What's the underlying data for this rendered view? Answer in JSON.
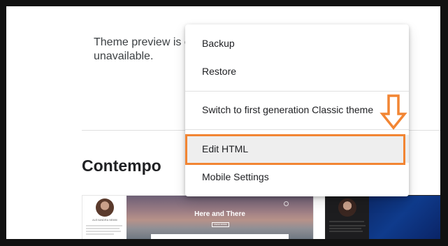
{
  "page": {
    "preview_line1": "Theme preview is c",
    "preview_line2": "unavailable.",
    "theme_name": "Contempo"
  },
  "menu": {
    "items": [
      {
        "label": "Backup"
      },
      {
        "label": "Restore"
      },
      {
        "label": "Switch to first generation Classic theme"
      },
      {
        "label": "Edit HTML",
        "highlighted": true
      },
      {
        "label": "Mobile Settings"
      }
    ]
  },
  "thumbnails": {
    "contempo_light": {
      "avatar_name": "ALEXANDRA NEMM",
      "hero_title": "Here and There",
      "hero_button": "READ MORE"
    },
    "contempo_dark": {
      "avatar_name": ""
    }
  },
  "annotation": {
    "color": "#f28533",
    "icon": "down-arrow-icon"
  },
  "colors": {
    "frame": "#111111",
    "menu_bg": "#ffffff",
    "menu_active_bg": "#eeeeee",
    "text": "#202124"
  }
}
